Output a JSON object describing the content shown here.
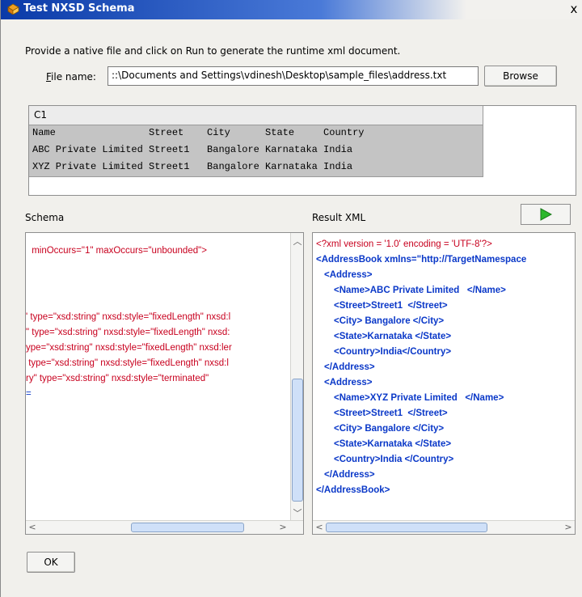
{
  "window": {
    "title": "Test NXSD Schema",
    "close_glyph": "x"
  },
  "instructions": "Provide a native file and click on Run to generate the runtime xml document.",
  "file": {
    "label": "File name:",
    "value": "::\\Documents and Settings\\vdinesh\\Desktop\\sample_files\\address.txt",
    "browse_label": "Browse"
  },
  "preview": {
    "header": "C1",
    "rows": [
      "Name                Street    City      State     Country",
      "ABC Private Limited Street1   Bangalore Karnataka India",
      "XYZ Private Limited Street1   Bangalore Karnataka India"
    ]
  },
  "schema": {
    "label": "Schema",
    "lines": [
      " minOccurs=\"1\" maxOccurs=\"unbounded\">",
      "' type=\"xsd:string\" nxsd:style=\"fixedLength\" nxsd:l",
      "\" type=\"xsd:string\" nxsd:style=\"fixedLength\" nxsd:",
      "ype=\"xsd:string\" nxsd:style=\"fixedLength\" nxsd:ler",
      " type=\"xsd:string\" nxsd:style=\"fixedLength\" nxsd:l",
      "ry\" type=\"xsd:string\" nxsd:style=\"terminated\"",
      "="
    ]
  },
  "result": {
    "label": "Result XML",
    "run_icon": "play-icon",
    "lines": [
      "<?xml version = '1.0' encoding = 'UTF-8'?>",
      "<AddressBook xmlns=\"http://TargetNamespace",
      "<Address>",
      "<Name>ABC Private Limited   </Name>",
      "<Street>Street1  </Street>",
      "<City> Bangalore </City>",
      "<State>Karnataka </State>",
      "<Country>India</Country>",
      "</Address>",
      "<Address>",
      "<Name>XYZ Private Limited   </Name>",
      "<Street>Street1  </Street>",
      "<City> Bangalore </City>",
      "<State>Karnataka </State>",
      "<Country>India </Country>",
      "</Address>",
      "</AddressBook>"
    ]
  },
  "ok_label": "OK",
  "colors": {
    "title_blue": "#0a3aa8",
    "xml_tag": "#0a38c8",
    "xml_attr": "#c8001e",
    "run_green": "#2cb82c"
  }
}
